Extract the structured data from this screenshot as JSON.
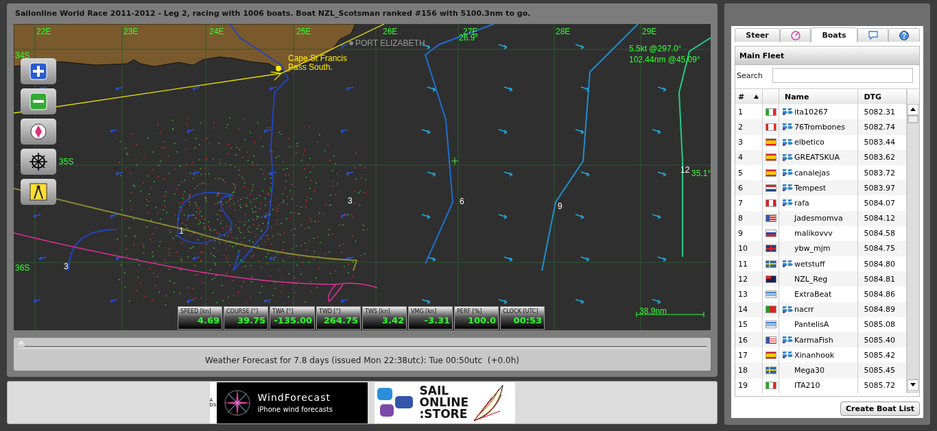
{
  "header": {
    "title": "Sailonline World Race 2011-2012 - Leg 2, racing with 1006 boats. Boat NZL_Scotsman ranked #156 with 5100.3nm to go."
  },
  "map": {
    "longitude_labels": [
      "22E",
      "23E",
      "24E",
      "25E",
      "26E",
      "27E",
      "28E",
      "29E"
    ],
    "latitude_labels": [
      "34S",
      "35S",
      "36S"
    ],
    "place_labels": [
      "PORT ELIZABETH"
    ],
    "waypoint_labels": [
      "Cape St Francis",
      "Pass South."
    ],
    "readouts": [
      "26.9°",
      "5.5kt @297.0°",
      "102.44nm @45.09°",
      "12",
      "35.1°"
    ],
    "isoline_labels": [
      "1",
      "3",
      "3",
      "6",
      "9"
    ],
    "scale": "38.9nm",
    "instruments": [
      {
        "label": "SPEED [kn]",
        "value": "4.69"
      },
      {
        "label": "COURSE [°]",
        "value": "39.75"
      },
      {
        "label": "TWA [°]",
        "value": "-135.00"
      },
      {
        "label": "TWD [°]",
        "value": "264.75"
      },
      {
        "label": "TWS [kn]",
        "value": "3.42"
      },
      {
        "label": "VMG [kn]",
        "value": "-3.31"
      },
      {
        "label": "PERF [%]",
        "value": "100.0"
      },
      {
        "label": "CLOCK [UTC]",
        "value": "00:53"
      }
    ]
  },
  "forecast": {
    "level": 0,
    "caption": "Weather Forecast for 7.8 days (issued Mon 22:38utc): Tue 00:50utc  (+0.0h)"
  },
  "ads": {
    "windforecast": {
      "side": "ADS",
      "title": "WindForecast",
      "subtitle": "iPhone wind forecasts"
    },
    "store": {
      "lines": [
        "SAIL",
        "ONLINE",
        ":STORE"
      ]
    }
  },
  "sidebar": {
    "tabs": [
      {
        "kind": "text",
        "label": "Steer",
        "selected": false
      },
      {
        "kind": "timer",
        "selected": false
      },
      {
        "kind": "text",
        "label": "Boats",
        "selected": true
      },
      {
        "kind": "chat",
        "selected": false
      },
      {
        "kind": "help",
        "selected": false
      }
    ],
    "fleet_title": "Main Fleet",
    "search_label": "Search",
    "table": {
      "columns": [
        "#",
        "Name",
        "DTG"
      ],
      "sort_ascending": true,
      "rows": [
        {
          "rank": "1",
          "kind": "italy",
          "member": true,
          "name": "ita10267",
          "dtg": "5082.31"
        },
        {
          "rank": "2",
          "kind": "canada",
          "member": true,
          "name": "76Trombones",
          "dtg": "5082.74"
        },
        {
          "rank": "3",
          "kind": "spain",
          "member": true,
          "name": "elbetico",
          "dtg": "5083.44"
        },
        {
          "rank": "4",
          "kind": "spain",
          "member": true,
          "name": "GREATSKUA",
          "dtg": "5083.62"
        },
        {
          "rank": "5",
          "kind": "spain",
          "member": true,
          "name": "canalejas",
          "dtg": "5083.72"
        },
        {
          "rank": "6",
          "kind": "netherlands",
          "member": true,
          "name": "Tempest",
          "dtg": "5083.97"
        },
        {
          "rank": "7",
          "kind": "peru",
          "member": true,
          "name": "rafa",
          "dtg": "5084.07"
        },
        {
          "rank": "8",
          "kind": "usa",
          "member": false,
          "name": "Jadesmomva",
          "dtg": "5084.12"
        },
        {
          "rank": "9",
          "kind": "russia",
          "member": false,
          "name": "malikovvv",
          "dtg": "5084.58"
        },
        {
          "rank": "10",
          "kind": "uk",
          "member": false,
          "name": "ybw_mjm",
          "dtg": "5084.75"
        },
        {
          "rank": "11",
          "kind": "sweden",
          "member": true,
          "name": "wetstuff",
          "dtg": "5084.80"
        },
        {
          "rank": "12",
          "kind": "newzealand",
          "member": false,
          "name": "NZL_Reg",
          "dtg": "5084.81"
        },
        {
          "rank": "13",
          "kind": "greece",
          "member": false,
          "name": "ExtraBeat",
          "dtg": "5084.86"
        },
        {
          "rank": "14",
          "kind": "portugal",
          "member": true,
          "name": "nacrr",
          "dtg": "5084.89"
        },
        {
          "rank": "15",
          "kind": "greece",
          "member": false,
          "name": "PantelisA",
          "dtg": "5085.08"
        },
        {
          "rank": "16",
          "kind": "usa",
          "member": true,
          "name": "KarmaFish",
          "dtg": "5085.40"
        },
        {
          "rank": "17",
          "kind": "spain",
          "member": true,
          "name": "Xinanhook",
          "dtg": "5085.42"
        },
        {
          "rank": "18",
          "kind": "sweden",
          "member": false,
          "name": "Mega30",
          "dtg": "5085.45"
        },
        {
          "rank": "19",
          "kind": "italy",
          "member": false,
          "name": "ITA210",
          "dtg": "5085.72"
        }
      ]
    },
    "create_button": "Create Boat List"
  }
}
